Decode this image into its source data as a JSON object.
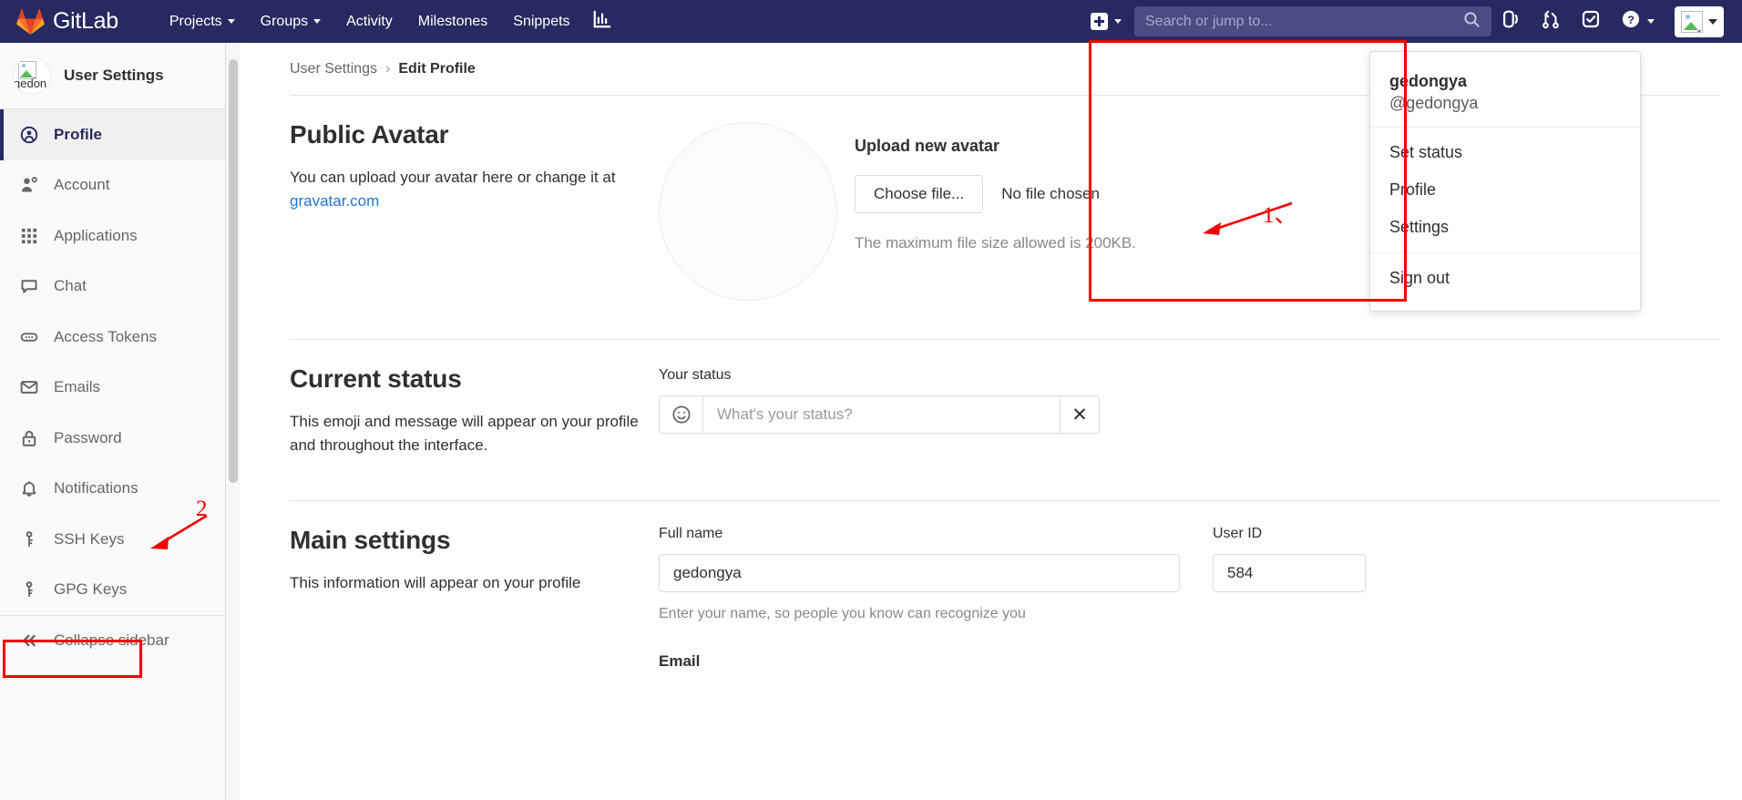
{
  "navbar": {
    "brand": "GitLab",
    "links": [
      {
        "label": "Projects",
        "has_caret": true
      },
      {
        "label": "Groups",
        "has_caret": true
      },
      {
        "label": "Activity",
        "has_caret": false
      },
      {
        "label": "Milestones",
        "has_caret": false
      },
      {
        "label": "Snippets",
        "has_caret": false
      }
    ],
    "analytics_icon": "chart-bar-icon",
    "create_new_icon": "plus-icon",
    "search": {
      "placeholder": "Search or jump to...",
      "value": "",
      "icon": "search-icon"
    },
    "right_icons": [
      "issues-icon",
      "merge-requests-icon",
      "todos-icon",
      "help-icon"
    ],
    "avatar_alt": "broken-image-icon"
  },
  "user_dropdown": {
    "name": "gedongya",
    "handle": "@gedongya",
    "items_primary": [
      "Set status",
      "Profile",
      "Settings"
    ],
    "items_secondary": [
      "Sign out"
    ]
  },
  "sidebar": {
    "title": "User Settings",
    "avatar_alt": "gedon",
    "items": [
      {
        "label": "Profile",
        "icon": "user-circle-icon",
        "active": true
      },
      {
        "label": "Account",
        "icon": "account-gear-icon",
        "active": false
      },
      {
        "label": "Applications",
        "icon": "grid-apps-icon",
        "active": false
      },
      {
        "label": "Chat",
        "icon": "comment-icon",
        "active": false
      },
      {
        "label": "Access Tokens",
        "icon": "token-icon",
        "active": false
      },
      {
        "label": "Emails",
        "icon": "envelope-icon",
        "active": false
      },
      {
        "label": "Password",
        "icon": "lock-icon",
        "active": false
      },
      {
        "label": "Notifications",
        "icon": "bell-icon",
        "active": false
      },
      {
        "label": "SSH Keys",
        "icon": "key-icon",
        "active": false
      },
      {
        "label": "GPG Keys",
        "icon": "key-icon",
        "active": false
      }
    ],
    "collapse": {
      "label": "Collapse sidebar",
      "icon": "double-chevron-left-icon"
    }
  },
  "breadcrumb": {
    "parent": "User Settings",
    "separator": "›",
    "current": "Edit Profile"
  },
  "public_avatar": {
    "title": "Public Avatar",
    "description_prefix": "You can upload your avatar here or change it at",
    "link": "gravatar.com",
    "upload_title": "Upload new avatar",
    "choose_button": "Choose file...",
    "no_file_text": "No file chosen",
    "max_size": "The maximum file size allowed is 200KB."
  },
  "current_status": {
    "title": "Current status",
    "description": "This emoji and message will appear on your profile and throughout the interface.",
    "field_label": "Your status",
    "emoji_icon": "smiley-icon",
    "placeholder": "What's your status?",
    "value": "",
    "clear_icon": "close-icon"
  },
  "main_settings": {
    "title": "Main settings",
    "description": "This information will appear on your profile",
    "full_name_label": "Full name",
    "full_name_value": "gedongya",
    "full_name_hint": "Enter your name, so people you know can recognize you",
    "user_id_label": "User ID",
    "user_id_value": "584",
    "email_label": "Email"
  },
  "annotations": {
    "marker_1": "1、",
    "marker_2": "2",
    "color": "#f20000"
  }
}
